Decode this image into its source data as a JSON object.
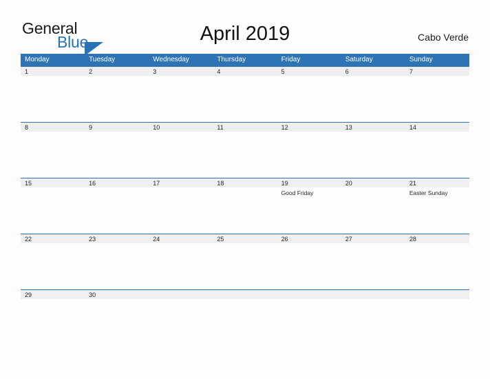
{
  "logo": {
    "word_one": "General",
    "word_two": "Blue",
    "triangle_icon": "triangle-icon",
    "brand_color": "#2673B8"
  },
  "header": {
    "title": "April 2019",
    "region": "Cabo Verde"
  },
  "theme": {
    "header_blue": "#2E74B5",
    "band_gray": "#EFEFEF",
    "page_background": "#FDFDFD",
    "text_dark": "#252525",
    "weekday_text": "#FFFFFF"
  },
  "calendar": {
    "weekdays": [
      "Monday",
      "Tuesday",
      "Wednesday",
      "Thursday",
      "Friday",
      "Saturday",
      "Sunday"
    ],
    "weeks": [
      [
        {
          "day": "1",
          "event": ""
        },
        {
          "day": "2",
          "event": ""
        },
        {
          "day": "3",
          "event": ""
        },
        {
          "day": "4",
          "event": ""
        },
        {
          "day": "5",
          "event": ""
        },
        {
          "day": "6",
          "event": ""
        },
        {
          "day": "7",
          "event": ""
        }
      ],
      [
        {
          "day": "8",
          "event": ""
        },
        {
          "day": "9",
          "event": ""
        },
        {
          "day": "10",
          "event": ""
        },
        {
          "day": "11",
          "event": ""
        },
        {
          "day": "12",
          "event": ""
        },
        {
          "day": "13",
          "event": ""
        },
        {
          "day": "14",
          "event": ""
        }
      ],
      [
        {
          "day": "15",
          "event": ""
        },
        {
          "day": "16",
          "event": ""
        },
        {
          "day": "17",
          "event": ""
        },
        {
          "day": "18",
          "event": ""
        },
        {
          "day": "19",
          "event": "Good Friday"
        },
        {
          "day": "20",
          "event": ""
        },
        {
          "day": "21",
          "event": "Easter Sunday"
        }
      ],
      [
        {
          "day": "22",
          "event": ""
        },
        {
          "day": "23",
          "event": ""
        },
        {
          "day": "24",
          "event": ""
        },
        {
          "day": "25",
          "event": ""
        },
        {
          "day": "26",
          "event": ""
        },
        {
          "day": "27",
          "event": ""
        },
        {
          "day": "28",
          "event": ""
        }
      ],
      [
        {
          "day": "29",
          "event": ""
        },
        {
          "day": "30",
          "event": ""
        },
        {
          "day": "",
          "event": ""
        },
        {
          "day": "",
          "event": ""
        },
        {
          "day": "",
          "event": ""
        },
        {
          "day": "",
          "event": ""
        },
        {
          "day": "",
          "event": ""
        }
      ]
    ]
  }
}
